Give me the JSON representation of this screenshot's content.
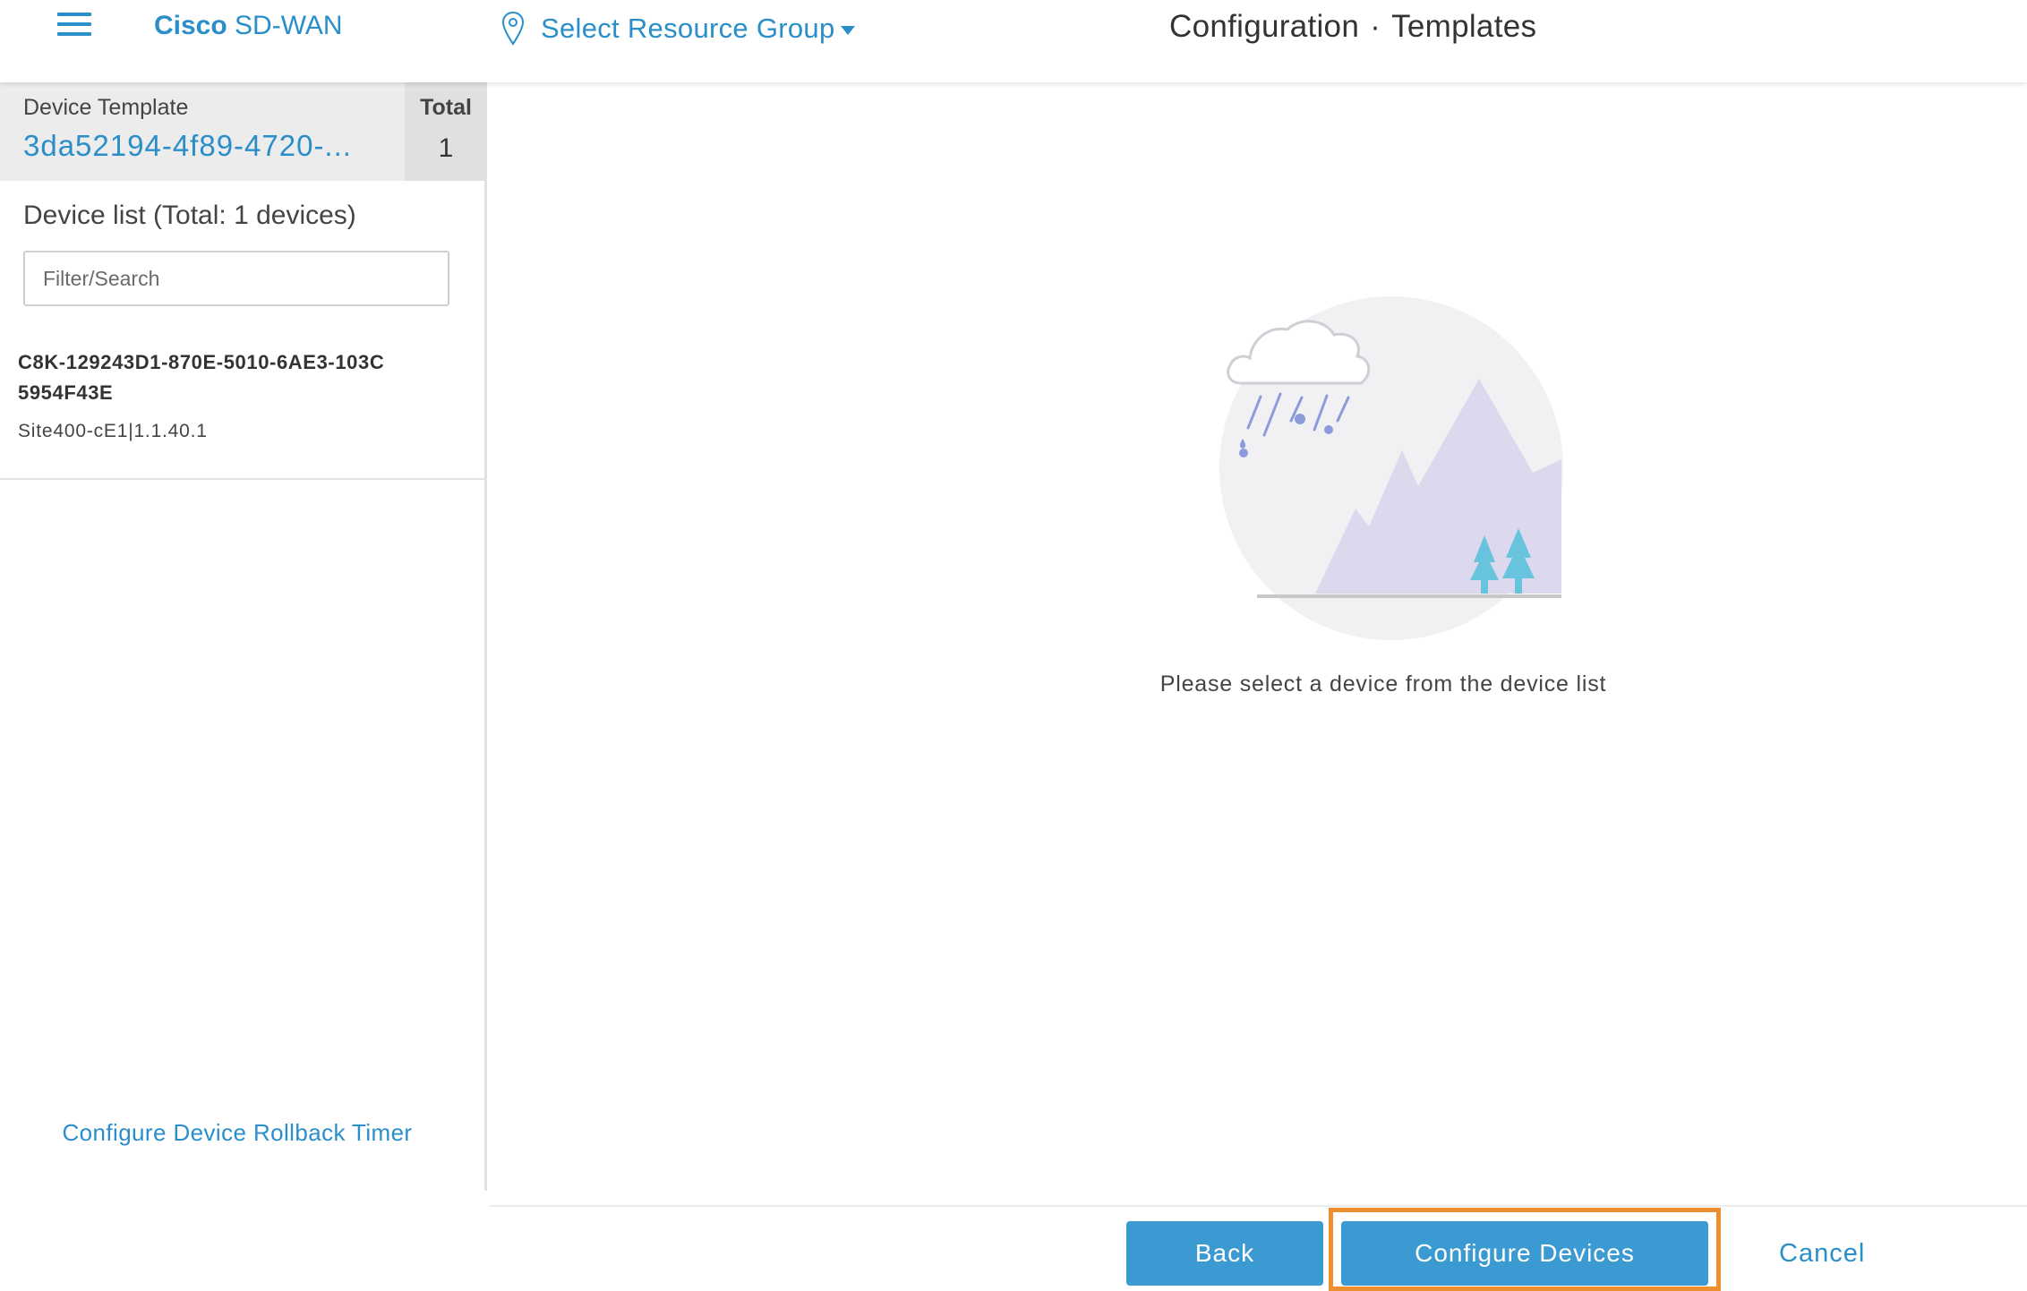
{
  "header": {
    "brand_prefix": "Cisco",
    "brand_name": "SD-WAN",
    "resource_group_label": "Select Resource Group",
    "title_section": "Configuration",
    "title_separator": "·",
    "title_page": "Templates"
  },
  "sidebar": {
    "template_label": "Device Template",
    "template_value": "3da52194-4f89-4720-...",
    "total_label": "Total",
    "total_value": "1",
    "device_list_title": "Device list (Total: 1 devices)",
    "filter_placeholder": "Filter/Search",
    "devices": [
      {
        "name": "C8K-129243D1-870E-5010-6AE3-103C5954F43E",
        "subtitle": "Site400-cE1|1.1.40.1"
      }
    ],
    "rollback_link": "Configure Device Rollback Timer"
  },
  "main": {
    "empty_message": "Please select a device from the device list",
    "illustration": "empty-state-rain-mountain"
  },
  "footer": {
    "back_label": "Back",
    "configure_label": "Configure Devices",
    "cancel_label": "Cancel"
  },
  "colors": {
    "accent": "#2a8ec9",
    "button": "#3b9ad1",
    "highlight": "#ee8e2e"
  }
}
